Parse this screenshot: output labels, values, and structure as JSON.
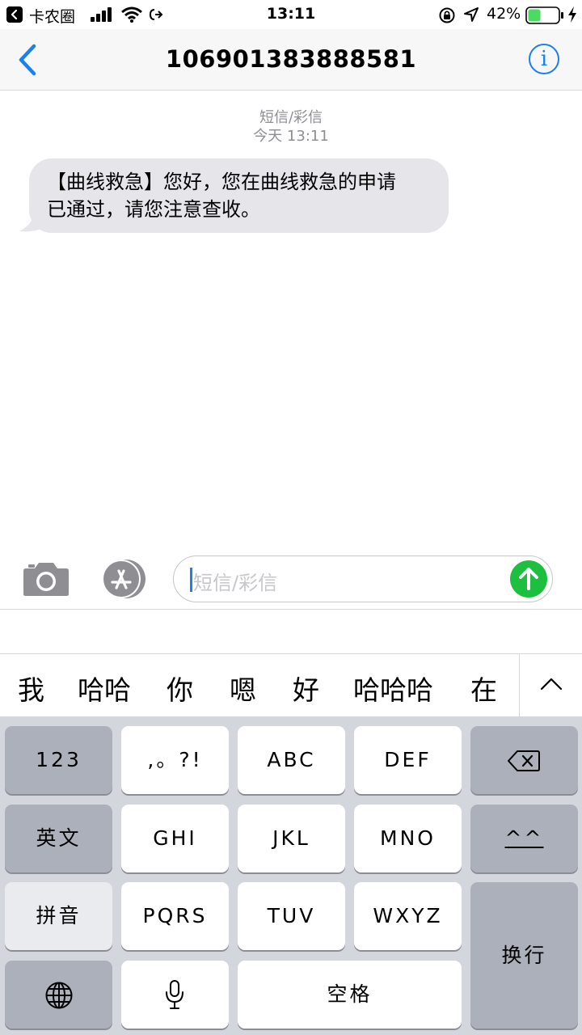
{
  "status_bar": {
    "carrier": "卡农圈",
    "time": "13:11",
    "battery_percent": "42%",
    "battery_level": 0.42,
    "battery_color": "#4cd964",
    "icons": [
      "back-to-app-icon",
      "signal-icon",
      "wifi-icon",
      "return-arrow-icon",
      "rotation-lock-icon",
      "location-icon",
      "battery-icon",
      "charging-bolt-icon"
    ]
  },
  "nav": {
    "title": "106901383888581",
    "back_icon": "chevron-left-icon",
    "info_icon": "info-icon",
    "info_glyph": "i",
    "accent_color": "#1a7ff0"
  },
  "thread": {
    "service_label": "短信/彩信",
    "timestamp": "今天 13:11",
    "messages": [
      {
        "direction": "incoming",
        "lines": [
          "【曲线救急】您好，您在曲线救急的申请",
          "已通过，请您注意查收。"
        ]
      }
    ]
  },
  "composer": {
    "placeholder": "短信/彩信",
    "camera_icon": "camera-icon",
    "apps_icon": "app-store-icon",
    "send_icon": "send-arrow-icon",
    "send_color": "#1dbf3e"
  },
  "predictions": {
    "items": [
      "我",
      "哈哈",
      "你",
      "嗯",
      "好",
      "哈哈哈",
      "在"
    ],
    "expand_icon": "chevron-up-icon"
  },
  "keyboard": {
    "row1": [
      "123",
      ",。?!",
      "ABC",
      "DEF"
    ],
    "row2": [
      "英文",
      "GHI",
      "JKL",
      "MNO",
      "^^"
    ],
    "row3": [
      "拼音",
      "PQRS",
      "TUV",
      "WXYZ"
    ],
    "return_label": "换行",
    "space_label": "空格",
    "delete_icon": "backspace-icon",
    "globe_icon": "globe-icon",
    "mic_icon": "microphone-icon"
  }
}
